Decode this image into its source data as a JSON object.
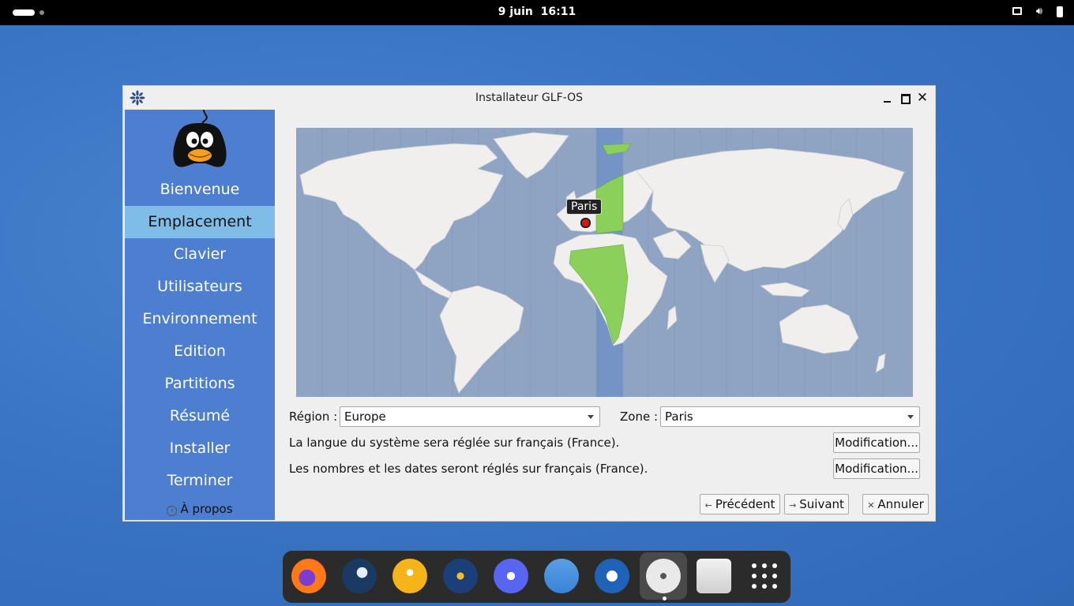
{
  "topbar": {
    "date": "9 juin",
    "time": "16:11"
  },
  "window": {
    "title": "Installateur GLF-OS",
    "minimize_label": "",
    "maximize_label": "",
    "close_label": "✕"
  },
  "sidebar": {
    "steps": [
      {
        "label": "Bienvenue",
        "active": false
      },
      {
        "label": "Emplacement",
        "active": true
      },
      {
        "label": "Clavier",
        "active": false
      },
      {
        "label": "Utilisateurs",
        "active": false
      },
      {
        "label": "Environnement",
        "active": false
      },
      {
        "label": "Edition",
        "active": false
      },
      {
        "label": "Partitions",
        "active": false
      },
      {
        "label": "Résumé",
        "active": false
      },
      {
        "label": "Installer",
        "active": false
      },
      {
        "label": "Terminer",
        "active": false
      }
    ],
    "about_label": "À propos"
  },
  "map": {
    "selected_city": "Paris"
  },
  "location": {
    "region_label": "Région :",
    "region_value": "Europe",
    "zone_label": "Zone :",
    "zone_value": "Paris",
    "language_text": "La langue du système sera réglée sur français (France).",
    "language_button": "Modification...",
    "formats_text": "Les nombres et les dates seront réglés sur français (France).",
    "formats_button": "Modification..."
  },
  "nav": {
    "back_label": "Précédent",
    "next_label": "Suivant",
    "cancel_label": "Annuler"
  },
  "dock": {
    "apps": [
      "firefox-icon",
      "steam-icon",
      "lutris-icon",
      "heroic-icon",
      "discord-icon",
      "files-icon",
      "virtualbox-icon",
      "installer-icon",
      "trash-icon"
    ]
  },
  "colors": {
    "sidebar": "#4e7ecf",
    "sidebar_active": "#7fbce8",
    "map_ocean": "#8fa3c3",
    "map_land": "#f1efed",
    "timezone_highlight": "#8bd05a"
  }
}
